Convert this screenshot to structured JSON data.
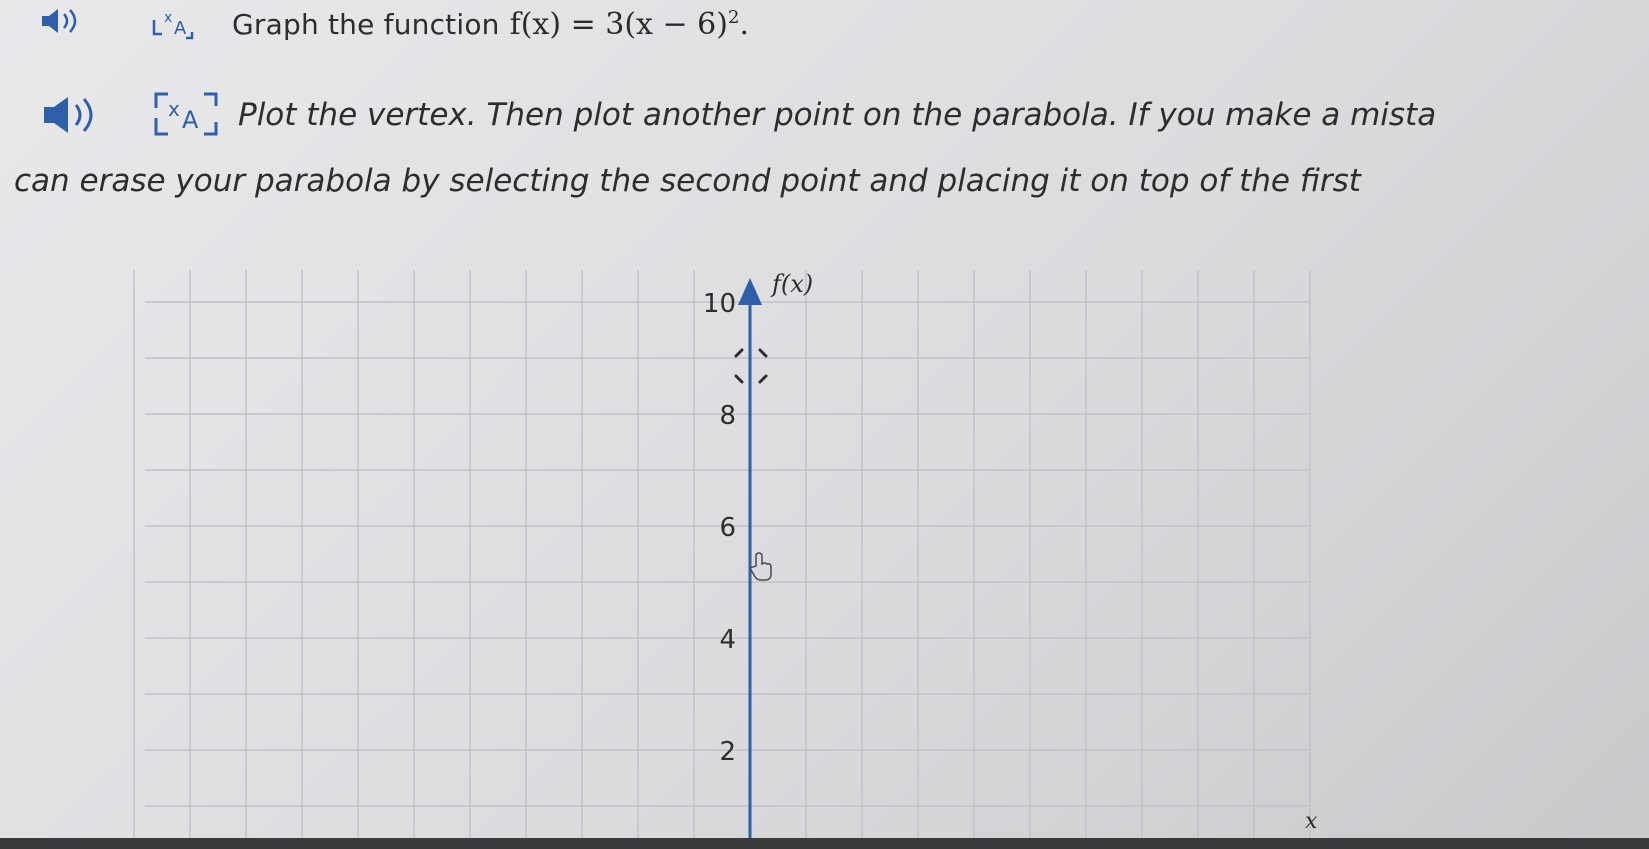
{
  "question": {
    "prompt": "Graph the function",
    "function_text": "f(x) = 3(x − 6)",
    "exponent": "2",
    "end_punct": "."
  },
  "instructions": {
    "line1": "Plot the vertex. Then plot another point on the parabola. If you make a mista",
    "line2": "can erase your parabola by selecting the second point and placing it on top of the first"
  },
  "graph": {
    "y_axis_label": "f(x)",
    "x_axis_label": "x",
    "y_ticks": [
      "10",
      "8",
      "6",
      "4",
      "2"
    ]
  },
  "colors": {
    "accent": "#2f5fa8",
    "grid": "#bfc3c8",
    "text": "#2d2d2d"
  }
}
